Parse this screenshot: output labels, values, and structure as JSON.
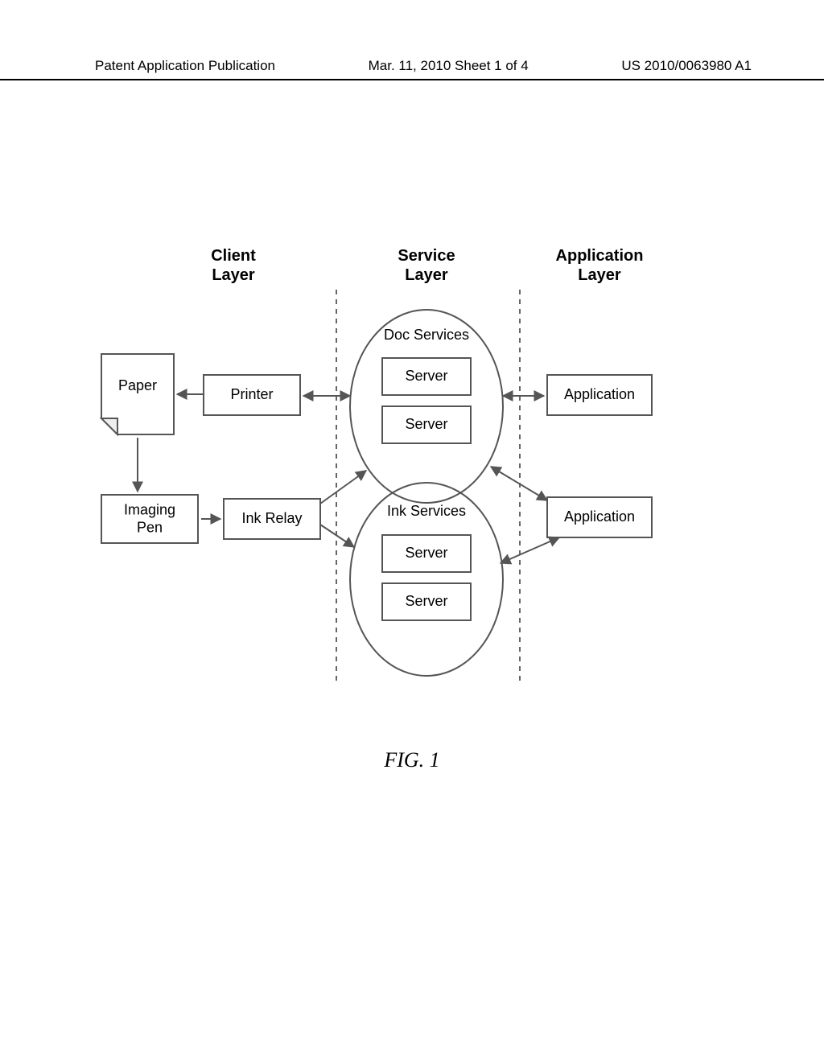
{
  "header": {
    "left": "Patent Application Publication",
    "mid": "Mar. 11, 2010  Sheet 1 of 4",
    "right": "US 2010/0063980 A1"
  },
  "layers": {
    "client": "Client\nLayer",
    "service": "Service\nLayer",
    "application": "Application\nLayer"
  },
  "nodes": {
    "paper": "Paper",
    "printer": "Printer",
    "imaging_pen": "Imaging\nPen",
    "ink_relay": "Ink Relay",
    "app1": "Application",
    "app2": "Application",
    "doc_services": "Doc Services",
    "ink_services": "Ink Services",
    "server1": "Server",
    "server2": "Server",
    "server3": "Server",
    "server4": "Server"
  },
  "figure_caption": "FIG. 1"
}
